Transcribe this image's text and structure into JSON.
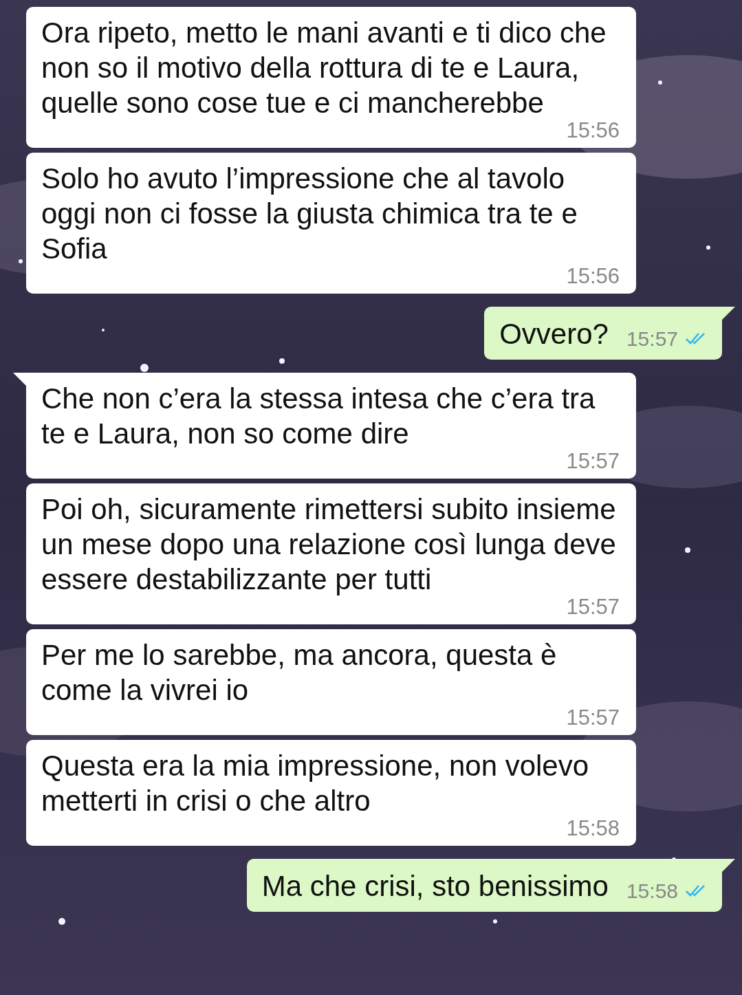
{
  "messages": [
    {
      "kind": "incoming",
      "tail": false,
      "text": "Ora ripeto, metto le mani avanti e ti dico che non so il motivo della rottura di te e Laura, quelle sono cose tue e ci mancherebbe",
      "time": "15:56"
    },
    {
      "kind": "incoming",
      "tail": false,
      "text": "Solo ho avuto l’impressione che al tavolo oggi non ci fosse la giusta chimica tra te e Sofia",
      "time": "15:56"
    },
    {
      "kind": "outgoing",
      "tail": true,
      "read": true,
      "text": "Ovvero?",
      "time": "15:57"
    },
    {
      "kind": "incoming",
      "tail": true,
      "text": "Che non c’era la stessa intesa che c’era tra te e Laura, non so come dire",
      "time": "15:57"
    },
    {
      "kind": "incoming",
      "tail": false,
      "text": "Poi oh, sicuramente rimettersi subito insieme un mese dopo una relazione così lunga deve essere destabilizzante per tutti",
      "time": "15:57"
    },
    {
      "kind": "incoming",
      "tail": false,
      "text": "Per me lo sarebbe, ma ancora, questa è come la vivrei io",
      "time": "15:57"
    },
    {
      "kind": "incoming",
      "tail": false,
      "text": "Questa era la mia impressione, non volevo metterti in crisi o che altro",
      "time": "15:58"
    },
    {
      "kind": "outgoing",
      "tail": true,
      "read": true,
      "text": "Ma che crisi, sto benissimo",
      "time": "15:58"
    }
  ]
}
